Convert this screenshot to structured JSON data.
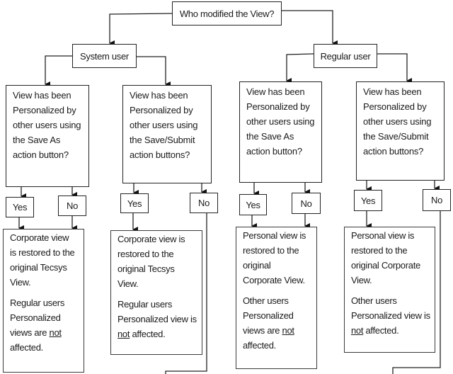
{
  "root": {
    "label": "Who modified the View?"
  },
  "branches": [
    {
      "label": "System user",
      "decisions": [
        {
          "question": [
            "View has been",
            "Personalized by",
            "other users using",
            "the Save As",
            "action button?"
          ],
          "yes": "Yes",
          "no": "No",
          "result": {
            "para1": [
              "Corporate view",
              "is restored to the",
              "original Tecsys",
              "View."
            ],
            "para2_lines": [
              "Regular users",
              "Personalized"
            ],
            "para2_pre": "views are ",
            "para2_underlined": "not",
            "para2_post": "affected."
          }
        },
        {
          "question": [
            "View has been",
            "Personalized by",
            "other users using",
            "the Save/Submit",
            "action buttons?"
          ],
          "yes": "Yes",
          "no": "No",
          "result": {
            "para1": [
              "Corporate view is",
              "restored to the",
              "original Tecsys",
              "View."
            ],
            "para2_lines": [
              "Regular users",
              "Personalized view is"
            ],
            "para2_underlined": "not",
            "para2_post": " affected."
          }
        }
      ]
    },
    {
      "label": "Regular user",
      "decisions": [
        {
          "question": [
            "View has been",
            "Personalized by",
            "other users using",
            "the Save As",
            "action button?"
          ],
          "yes": "Yes",
          "no": "No",
          "result": {
            "para1": [
              "Personal view is",
              "restored to the",
              "original",
              "Corporate View."
            ],
            "para2_lines": [
              "Other users",
              "Personalized"
            ],
            "para2_pre": "views are ",
            "para2_underlined": "not",
            "para2_post": "affected."
          }
        },
        {
          "question": [
            "View has been",
            "Personalized by",
            "other users using",
            "the Save/Submit",
            "action buttons?"
          ],
          "yes": "Yes",
          "no": "No",
          "result": {
            "para1": [
              "Personal view is",
              "restored to the",
              "original Corporate",
              "View."
            ],
            "para2_lines": [
              "Other users",
              "Personalized view is"
            ],
            "para2_underlined": "not",
            "para2_post": " affected."
          }
        }
      ]
    }
  ]
}
